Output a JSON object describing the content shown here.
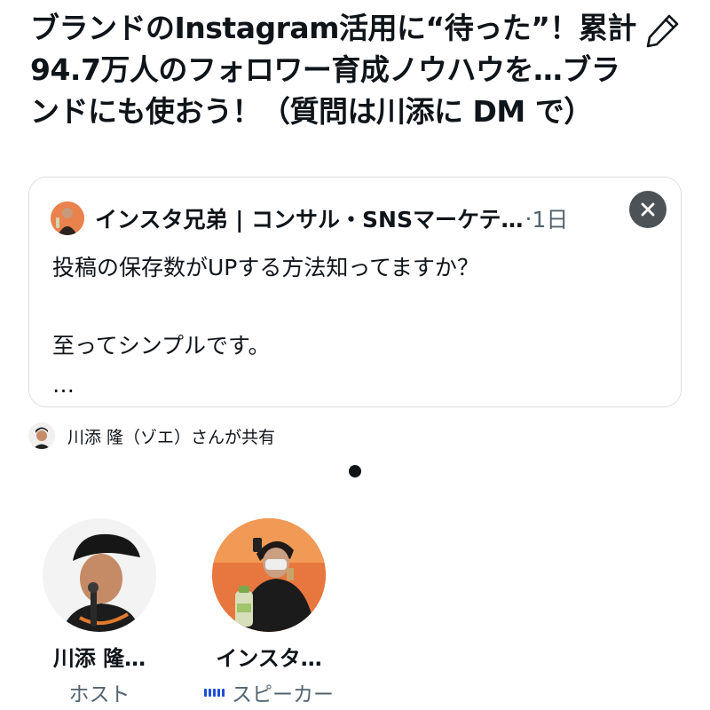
{
  "space": {
    "title": "ブランドのInstagram活用に“待った”！累計94.7万人のフォロワー育成ノウハウを…ブランドにも使おう！（質問は川添に DM で）"
  },
  "icons": {
    "edit": "pencil-icon",
    "close": "close-icon",
    "speaking": "audio-wave-icon"
  },
  "pinned_tweet": {
    "author": "インスタ兄弟 | コンサル・SNSマーケテ…",
    "separator": "·",
    "time": "1日",
    "lines": [
      "投稿の保存数がUPする方法知ってますか？",
      "",
      "至ってシンプルです。",
      "…"
    ],
    "shared_by": "川添 隆（ゾエ）さんが共有"
  },
  "pager": {
    "current": 1,
    "total": 1
  },
  "participants": [
    {
      "name": "川添 隆…",
      "role": "ホスト"
    },
    {
      "name": "インスタ…",
      "role": "スピーカー"
    }
  ],
  "colors": {
    "text": "#0f1419",
    "secondary": "#536471",
    "close_bg": "#4d5257",
    "wave": "#1d4ed8"
  }
}
